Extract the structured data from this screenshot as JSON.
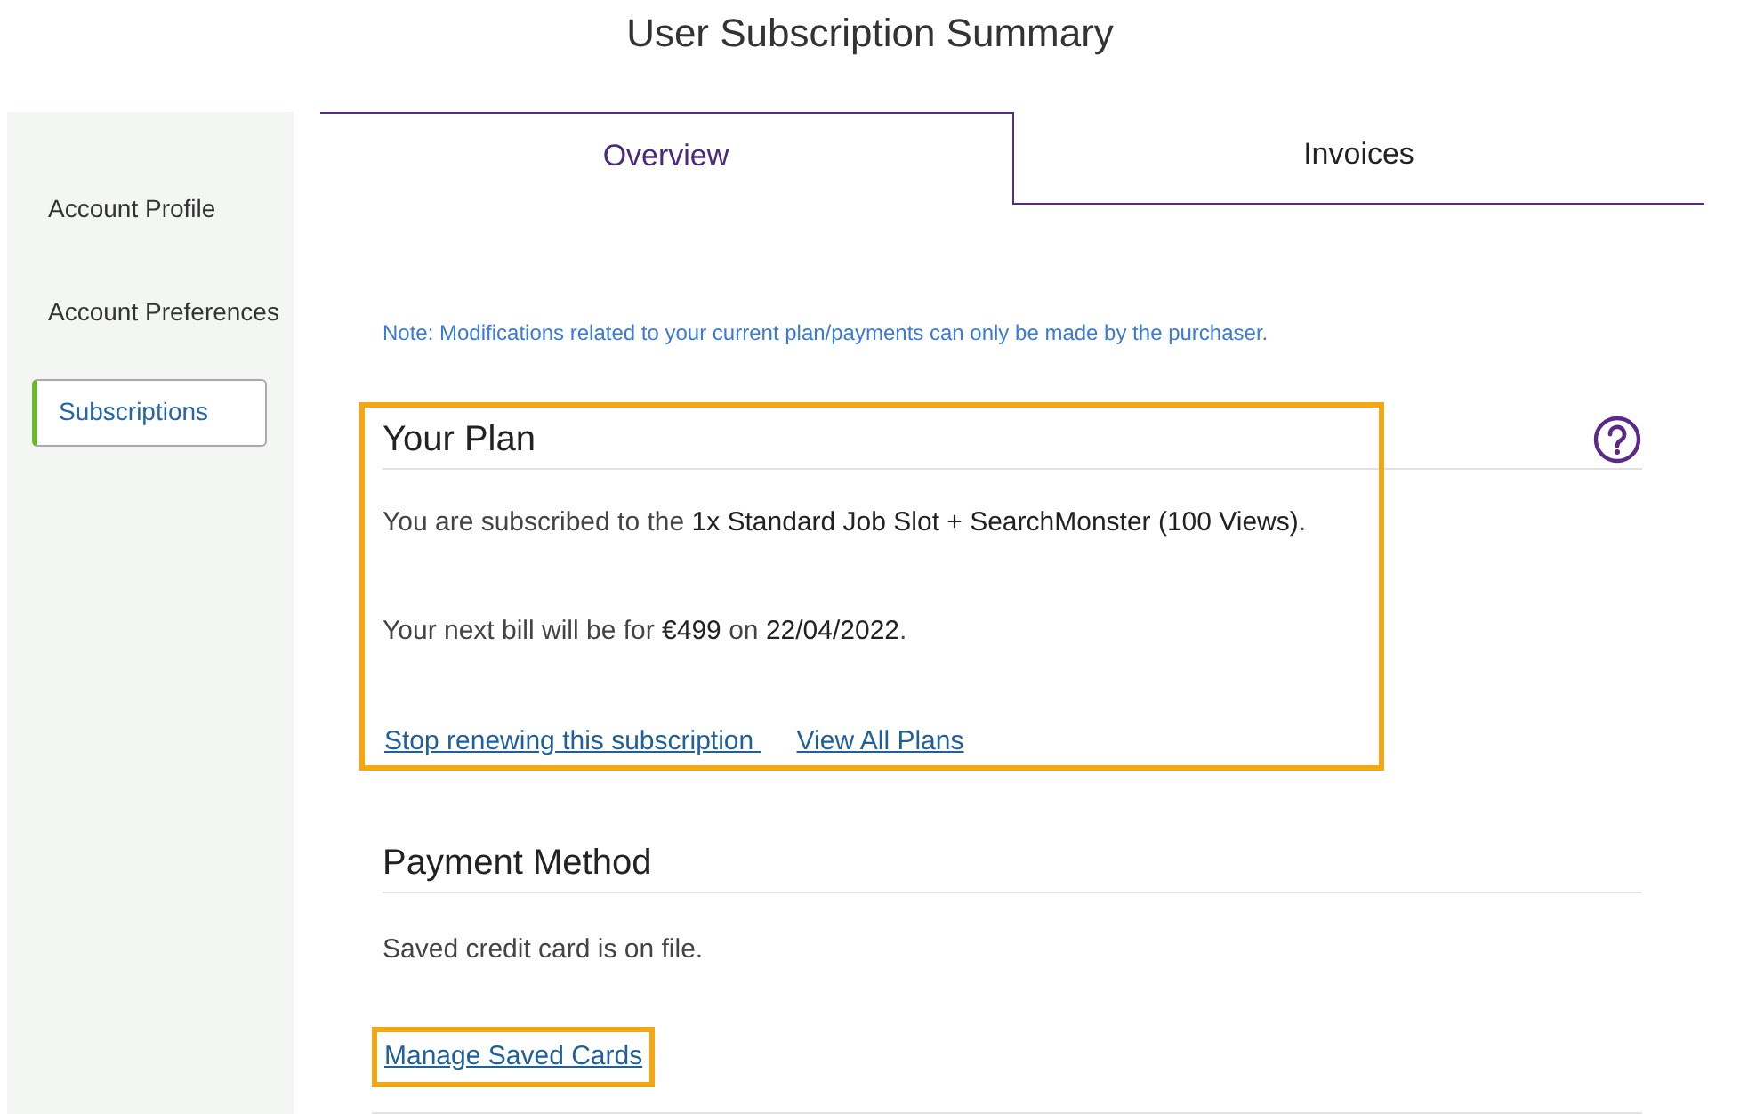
{
  "page_title": "User Subscription Summary",
  "sidebar": {
    "items": [
      {
        "label": "Account Profile",
        "selected": false
      },
      {
        "label": "Account Preferences",
        "selected": false
      },
      {
        "label": "Subscriptions",
        "selected": true
      }
    ]
  },
  "tabs": [
    {
      "label": "Overview",
      "selected": true
    },
    {
      "label": "Invoices",
      "selected": false
    }
  ],
  "note": "Note: Modifications related to your current plan/payments can only be made by the purchaser.",
  "plan": {
    "heading": "Your Plan",
    "highlighted": true,
    "subscription_text": "You are subscribed to the **1x Standard Job Slot + SearchMonster (100 Views)**.",
    "bill_text": "Your next bill will be for **€499** on **22/04/2022**.",
    "links": [
      "Stop renewing this subscription ",
      "View All Plans"
    ]
  },
  "payment": {
    "heading": "Payment Method",
    "text": "Saved credit card is on file.",
    "link": "Manage Saved Cards",
    "link_highlighted": true
  }
}
